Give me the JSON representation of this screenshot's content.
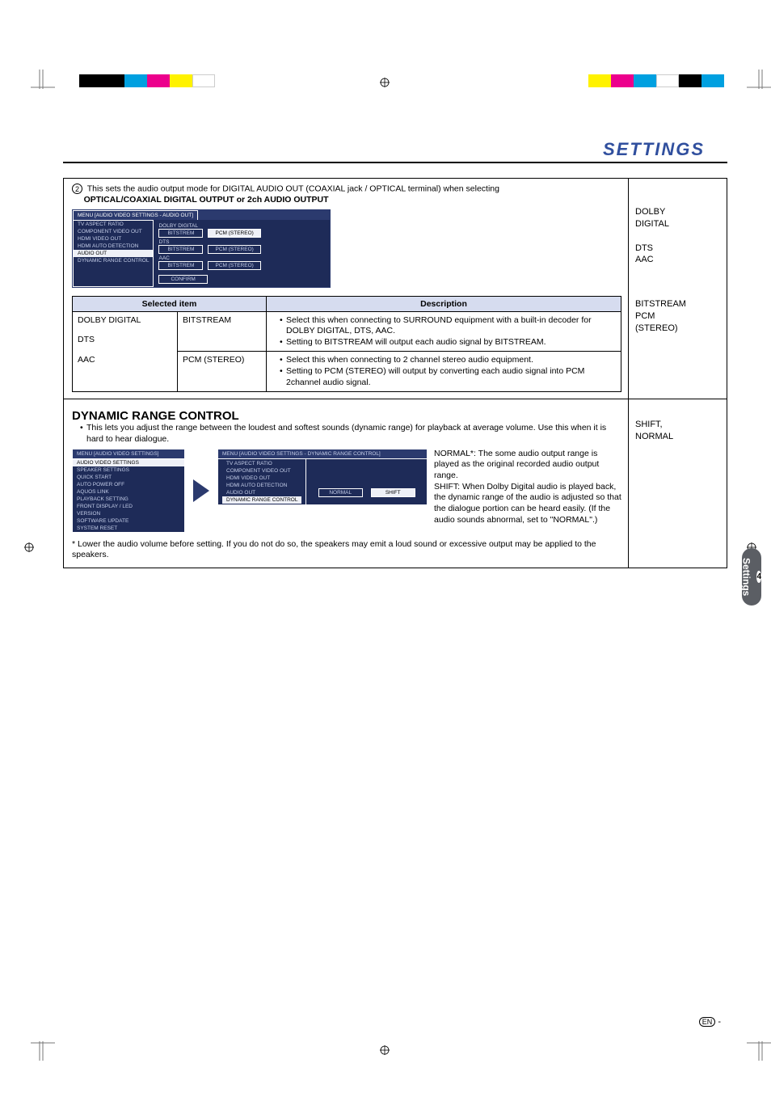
{
  "header": {
    "title": "SETTINGS"
  },
  "section2": {
    "num": "2",
    "intro_line1": "This sets the audio output mode for DIGITAL AUDIO OUT (COAXIAL jack / OPTICAL terminal) when selecting",
    "intro_line2_bold": "OPTICAL/COAXIAL DIGITAL OUTPUT or 2ch AUDIO OUTPUT",
    "osd": {
      "crumb": "MENU   [AUDIO VIDEO SETTINGS -  AUDIO OUT]",
      "list": [
        "TV ASPECT RATIO",
        "COMPONENT VIDEO OUT",
        "HDMI VIDEO OUT",
        "HDMI AUTO DETECTION",
        "AUDIO OUT",
        "DYNAMIC RANGE CONTROL"
      ],
      "selected_list_item": "AUDIO OUT",
      "groups": [
        {
          "label": "DOLBY DIGITAL",
          "opts": [
            "BITSTREM",
            "PCM (STEREO)"
          ],
          "sel": 1
        },
        {
          "label": "DTS",
          "opts": [
            "BITSTREM",
            "PCM (STEREO)"
          ],
          "sel": -1
        },
        {
          "label": "AAC",
          "opts": [
            "BITSTREM",
            "PCM (STEREO)"
          ],
          "sel": -1
        }
      ],
      "confirm": "CONFIRM"
    },
    "right_top": "DOLBY\n  DIGITAL\n\nDTS\nAAC",
    "right_bottom": "BITSTREAM\nPCM\n(STEREO)",
    "table": {
      "h1": "Selected item",
      "h2": "Description",
      "r1c1": "DOLBY DIGITAL",
      "r1c2": "BITSTREAM",
      "r1c3a": "Select this when connecting to SURROUND equipment with a built-in decoder for DOLBY DIGITAL, DTS, AAC.",
      "r1c3b": "Setting to BITSTREAM will output each audio signal by BITSTREAM.",
      "r2c1": "DTS",
      "r3c1": "AAC",
      "r3c2": "PCM (STEREO)",
      "r3c3a": "Select this when connecting to 2 channel stereo audio equipment.",
      "r3c3b": "Setting to PCM (STEREO) will output by converting each audio signal into PCM 2channel audio signal."
    }
  },
  "drc": {
    "title": "DYNAMIC RANGE CONTROL",
    "desc": "This lets you adjust the range between the loudest and softest sounds (dynamic range) for playback at average volume. Use this when it is hard to hear dialogue.",
    "menu1_hdr": "MENU   [AUDIO VIDEO SETTINGS]",
    "menu1_items": [
      "AUDIO VIDEO SETTINGS",
      "SPEAKER SETTINGS",
      "QUICK START",
      "AUTO POWER OFF",
      "AQUOS LINK",
      "PLAYBACK SETTING",
      "FRONT DISPLAY / LED",
      "VERSION",
      "SOFTWARE UPDATE",
      "SYSTEM RESET"
    ],
    "menu1_sel": "AUDIO VIDEO SETTINGS",
    "menu2_hdr": "MENU   [AUDIO VIDEO SETTINGS -  DYNAMIC RANGE CONTROL]",
    "menu2_list": [
      "TV ASPECT RATIO",
      "COMPONENT VIDEO OUT",
      "HDMI VIDEO OUT",
      "HDMI AUTO DETECTION",
      "AUDIO OUT",
      "DYNAMIC RANGE CONTROL"
    ],
    "menu2_sel": "DYNAMIC RANGE CONTROL",
    "btn_normal": "NORMAL",
    "btn_shift": "SHIFT",
    "explain": "NORMAL*: The some audio output range is played as the original recorded audio output range.\nSHIFT: When Dolby Digital audio is played back, the dynamic range of the audio is adjusted so that the dialogue portion can be heard easily. (If the audio sounds abnormal, set to \"NORMAL\".)",
    "right": "SHIFT,\nNORMAL",
    "footnote": "*  Lower the audio volume before setting. If you do not do so, the speakers may emit a loud sound or excessive output may be applied to the speakers."
  },
  "sidetab": {
    "num": "4",
    "label": "Settings"
  },
  "pagenum": {
    "en": "EN",
    "dash": " - "
  },
  "colors": {
    "bars_left": [
      "#000000",
      "#000000",
      "#00a0e0",
      "#ec008c",
      "#fff200",
      "#ffffff"
    ],
    "bars_right": [
      "#fff200",
      "#ec008c",
      "#00a0e0",
      "#ffffff",
      "#000000",
      "#00a0e0"
    ]
  }
}
